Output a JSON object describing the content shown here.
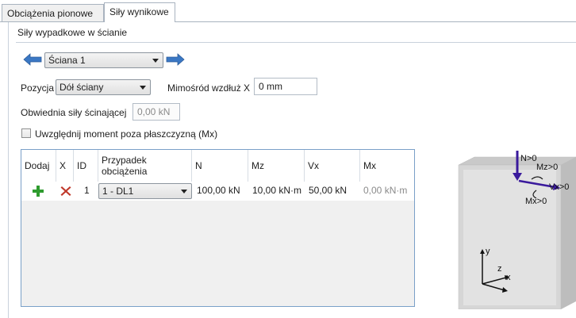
{
  "tabs": [
    {
      "label": "Obciążenia pionowe"
    },
    {
      "label": "Siły wynikowe"
    }
  ],
  "section": {
    "title": "Siły wypadkowe w ścianie"
  },
  "wall_selector": {
    "value": "Ściana 1"
  },
  "position": {
    "label": "Pozycja",
    "value": "Dół ściany"
  },
  "eccentricity": {
    "label": "Mimośród wzdłuż X",
    "value": "0 mm"
  },
  "shear_envelope": {
    "label": "Obwiednia siły ścinającej",
    "value": "0,00 kN"
  },
  "moment_checkbox": {
    "label": "Uwzględnij moment poza płaszczyzną (Mx)",
    "checked": false
  },
  "grid": {
    "columns": [
      "Dodaj",
      "X",
      "ID",
      "Przypadek obciążenia",
      "N",
      "Mz",
      "Vx",
      "Mx"
    ],
    "rows": [
      {
        "id": "1",
        "load_case": "1 - DL1",
        "N": "100,00 kN",
        "Mz": "10,00 kN·m",
        "Vx": "50,00 kN",
        "Mx": "0,00 kN·m"
      }
    ]
  },
  "figure": {
    "labels": {
      "N": "N>0",
      "Mz": "Mz>0",
      "Vx": "Vx>0",
      "Mx": "Mx>0",
      "y": "y",
      "z": "z",
      "x": "x"
    },
    "arrow_color": "#3a1a9c"
  },
  "colors": {
    "accent": "#3b78c4",
    "add": "#2e9b2e",
    "delete": "#c0392b"
  }
}
